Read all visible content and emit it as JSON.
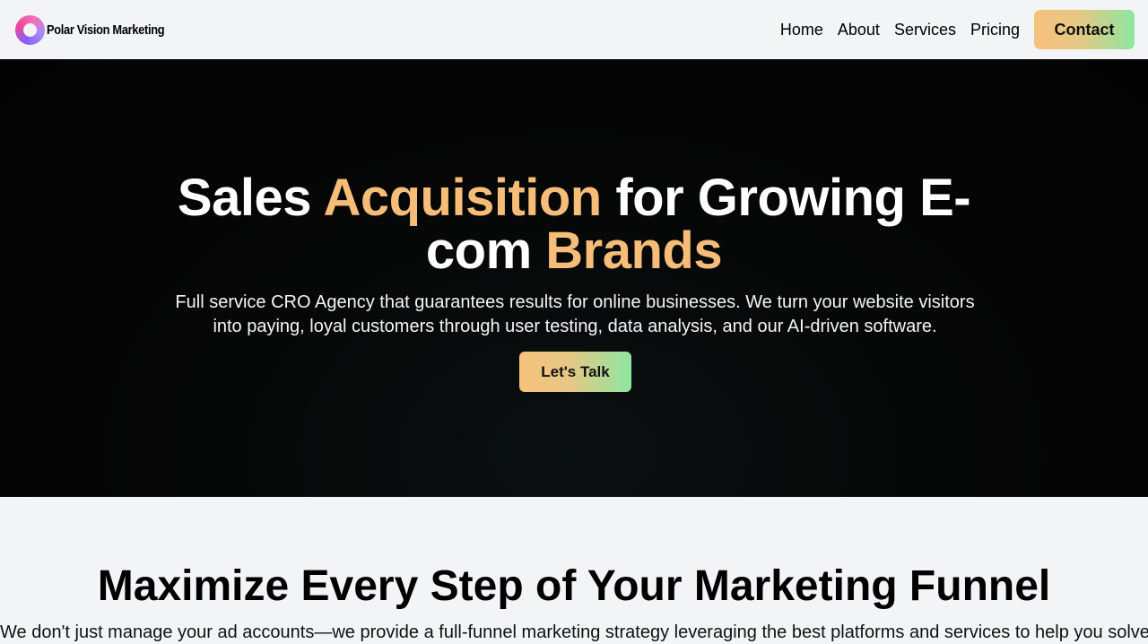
{
  "header": {
    "brand_name": "Polar Vision Marketing",
    "nav": [
      {
        "label": "Home"
      },
      {
        "label": "About"
      },
      {
        "label": "Services"
      },
      {
        "label": "Pricing"
      }
    ],
    "contact_label": "Contact"
  },
  "hero": {
    "title_part1": "Sales ",
    "title_accent1": "Acquisition",
    "title_part2": " for Growing E-com ",
    "title_accent2": "Brands",
    "subtitle": "Full service CRO Agency that guarantees results for online businesses. We turn your website visitors into paying, loyal customers through user testing, data analysis, and our AI-driven software.",
    "cta_label": "Let's Talk"
  },
  "funnel_section": {
    "title": "Maximize Every Step of Your Marketing Funnel",
    "subtitle": "We don't just manage your ad accounts—we provide a full-funnel marketing strategy leveraging the best platforms and services to help you solve"
  },
  "colors": {
    "accent": "#f6bd78",
    "gradient_start": "#f6c17c",
    "gradient_end": "#8ee6a0",
    "hero_bg": "#050505",
    "page_bg": "#f3f4f6"
  },
  "icons": {
    "logo": "gradient-ring-logo-icon"
  }
}
